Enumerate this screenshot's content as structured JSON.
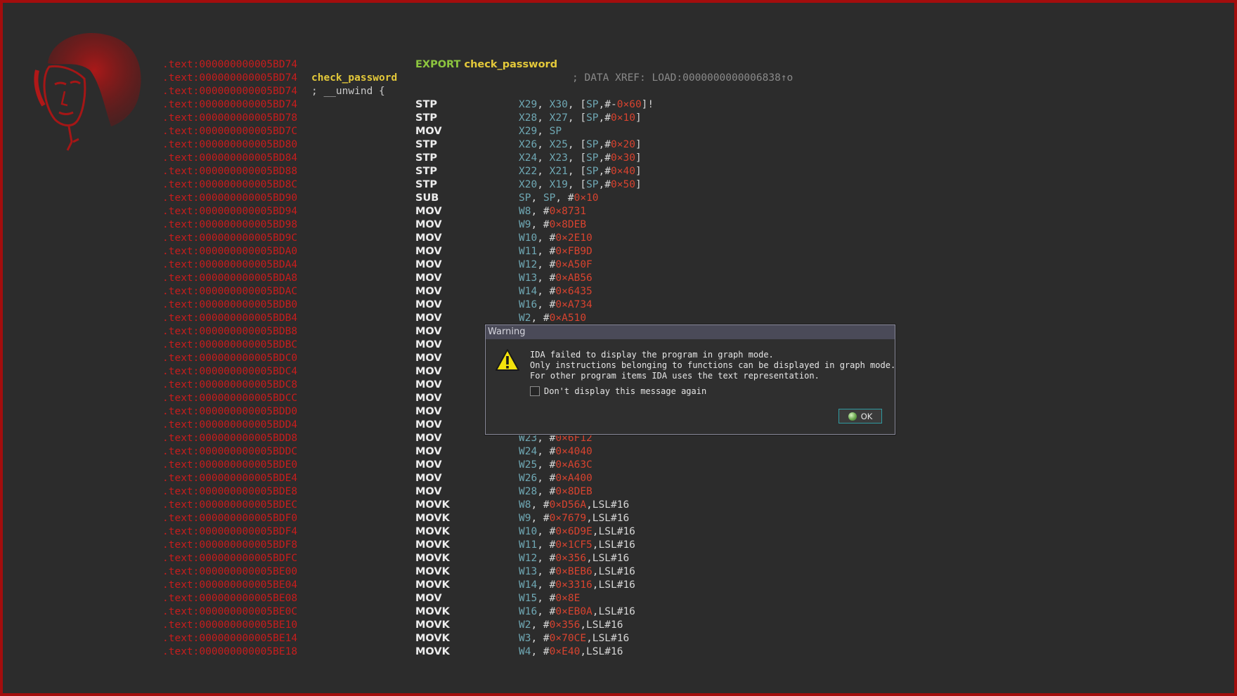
{
  "listing": [
    {
      "addr": ".text:000000000005BD74",
      "label": "",
      "mnem": "EXPORT",
      "name": "check_password",
      "ops": [],
      "comment": ""
    },
    {
      "addr": ".text:000000000005BD74",
      "label": "check_password",
      "mnem": "",
      "ops": [],
      "comment": "; DATA XREF: LOAD:0000000000006838↑o"
    },
    {
      "addr": ".text:000000000005BD74",
      "label": "; __unwind {",
      "label_plain": true,
      "mnem": "",
      "ops": [],
      "comment": ""
    },
    {
      "addr": ".text:000000000005BD74",
      "mnem": "STP",
      "ops": [
        [
          "r",
          "X29"
        ],
        [
          "p",
          ", "
        ],
        [
          "r",
          "X30"
        ],
        [
          "p",
          ", ["
        ],
        [
          "r",
          "SP"
        ],
        [
          "p",
          ",#-"
        ],
        [
          "n",
          "0×60"
        ],
        [
          "p",
          "]!"
        ]
      ]
    },
    {
      "addr": ".text:000000000005BD78",
      "mnem": "STP",
      "ops": [
        [
          "r",
          "X28"
        ],
        [
          "p",
          ", "
        ],
        [
          "r",
          "X27"
        ],
        [
          "p",
          ", ["
        ],
        [
          "r",
          "SP"
        ],
        [
          "p",
          ",#"
        ],
        [
          "n",
          "0×10"
        ],
        [
          "p",
          "]"
        ]
      ]
    },
    {
      "addr": ".text:000000000005BD7C",
      "mnem": "MOV",
      "ops": [
        [
          "r",
          "X29"
        ],
        [
          "p",
          ", "
        ],
        [
          "r",
          "SP"
        ]
      ]
    },
    {
      "addr": ".text:000000000005BD80",
      "mnem": "STP",
      "ops": [
        [
          "r",
          "X26"
        ],
        [
          "p",
          ", "
        ],
        [
          "r",
          "X25"
        ],
        [
          "p",
          ", ["
        ],
        [
          "r",
          "SP"
        ],
        [
          "p",
          ",#"
        ],
        [
          "n",
          "0×20"
        ],
        [
          "p",
          "]"
        ]
      ]
    },
    {
      "addr": ".text:000000000005BD84",
      "mnem": "STP",
      "ops": [
        [
          "r",
          "X24"
        ],
        [
          "p",
          ", "
        ],
        [
          "r",
          "X23"
        ],
        [
          "p",
          ", ["
        ],
        [
          "r",
          "SP"
        ],
        [
          "p",
          ",#"
        ],
        [
          "n",
          "0×30"
        ],
        [
          "p",
          "]"
        ]
      ]
    },
    {
      "addr": ".text:000000000005BD88",
      "mnem": "STP",
      "ops": [
        [
          "r",
          "X22"
        ],
        [
          "p",
          ", "
        ],
        [
          "r",
          "X21"
        ],
        [
          "p",
          ", ["
        ],
        [
          "r",
          "SP"
        ],
        [
          "p",
          ",#"
        ],
        [
          "n",
          "0×40"
        ],
        [
          "p",
          "]"
        ]
      ]
    },
    {
      "addr": ".text:000000000005BD8C",
      "mnem": "STP",
      "ops": [
        [
          "r",
          "X20"
        ],
        [
          "p",
          ", "
        ],
        [
          "r",
          "X19"
        ],
        [
          "p",
          ", ["
        ],
        [
          "r",
          "SP"
        ],
        [
          "p",
          ",#"
        ],
        [
          "n",
          "0×50"
        ],
        [
          "p",
          "]"
        ]
      ]
    },
    {
      "addr": ".text:000000000005BD90",
      "mnem": "SUB",
      "ops": [
        [
          "r",
          "SP"
        ],
        [
          "p",
          ", "
        ],
        [
          "r",
          "SP"
        ],
        [
          "p",
          ", #"
        ],
        [
          "n",
          "0×10"
        ]
      ]
    },
    {
      "addr": ".text:000000000005BD94",
      "mnem": "MOV",
      "ops": [
        [
          "r",
          "W8"
        ],
        [
          "p",
          ", #"
        ],
        [
          "n",
          "0×8731"
        ]
      ]
    },
    {
      "addr": ".text:000000000005BD98",
      "mnem": "MOV",
      "ops": [
        [
          "r",
          "W9"
        ],
        [
          "p",
          ", #"
        ],
        [
          "n",
          "0×8DEB"
        ]
      ]
    },
    {
      "addr": ".text:000000000005BD9C",
      "mnem": "MOV",
      "ops": [
        [
          "r",
          "W10"
        ],
        [
          "p",
          ", #"
        ],
        [
          "n",
          "0×2E10"
        ]
      ]
    },
    {
      "addr": ".text:000000000005BDA0",
      "mnem": "MOV",
      "ops": [
        [
          "r",
          "W11"
        ],
        [
          "p",
          ", #"
        ],
        [
          "n",
          "0×FB9D"
        ]
      ]
    },
    {
      "addr": ".text:000000000005BDA4",
      "mnem": "MOV",
      "ops": [
        [
          "r",
          "W12"
        ],
        [
          "p",
          ", #"
        ],
        [
          "n",
          "0×A50F"
        ]
      ]
    },
    {
      "addr": ".text:000000000005BDA8",
      "mnem": "MOV",
      "ops": [
        [
          "r",
          "W13"
        ],
        [
          "p",
          ", #"
        ],
        [
          "n",
          "0×AB56"
        ]
      ]
    },
    {
      "addr": ".text:000000000005BDAC",
      "mnem": "MOV",
      "ops": [
        [
          "r",
          "W14"
        ],
        [
          "p",
          ", #"
        ],
        [
          "n",
          "0×6435"
        ]
      ]
    },
    {
      "addr": ".text:000000000005BDB0",
      "mnem": "MOV",
      "ops": [
        [
          "r",
          "W16"
        ],
        [
          "p",
          ", #"
        ],
        [
          "n",
          "0×A734"
        ]
      ]
    },
    {
      "addr": ".text:000000000005BDB4",
      "mnem": "MOV",
      "ops": [
        [
          "r",
          "W2"
        ],
        [
          "p",
          ", #"
        ],
        [
          "n",
          "0×A510"
        ]
      ]
    },
    {
      "addr": ".text:000000000005BDB8",
      "mnem": "MOV",
      "ops": []
    },
    {
      "addr": ".text:000000000005BDBC",
      "mnem": "MOV",
      "ops": []
    },
    {
      "addr": ".text:000000000005BDC0",
      "mnem": "MOV",
      "ops": []
    },
    {
      "addr": ".text:000000000005BDC4",
      "mnem": "MOV",
      "ops": []
    },
    {
      "addr": ".text:000000000005BDC8",
      "mnem": "MOV",
      "ops": []
    },
    {
      "addr": ".text:000000000005BDCC",
      "mnem": "MOV",
      "ops": []
    },
    {
      "addr": ".text:000000000005BDD0",
      "mnem": "MOV",
      "ops": []
    },
    {
      "addr": ".text:000000000005BDD4",
      "mnem": "MOV",
      "ops": []
    },
    {
      "addr": ".text:000000000005BDD8",
      "mnem": "MOV",
      "ops": [
        [
          "r",
          "W23"
        ],
        [
          "p",
          ", #"
        ],
        [
          "n",
          "0×6F12"
        ]
      ]
    },
    {
      "addr": ".text:000000000005BDDC",
      "mnem": "MOV",
      "ops": [
        [
          "r",
          "W24"
        ],
        [
          "p",
          ", #"
        ],
        [
          "n",
          "0×4040"
        ]
      ]
    },
    {
      "addr": ".text:000000000005BDE0",
      "mnem": "MOV",
      "ops": [
        [
          "r",
          "W25"
        ],
        [
          "p",
          ", #"
        ],
        [
          "n",
          "0×A63C"
        ]
      ]
    },
    {
      "addr": ".text:000000000005BDE4",
      "mnem": "MOV",
      "ops": [
        [
          "r",
          "W26"
        ],
        [
          "p",
          ", #"
        ],
        [
          "n",
          "0×A400"
        ]
      ]
    },
    {
      "addr": ".text:000000000005BDE8",
      "mnem": "MOV",
      "ops": [
        [
          "r",
          "W28"
        ],
        [
          "p",
          ", #"
        ],
        [
          "n",
          "0×8DEB"
        ]
      ]
    },
    {
      "addr": ".text:000000000005BDEC",
      "mnem": "MOVK",
      "ops": [
        [
          "r",
          "W8"
        ],
        [
          "p",
          ", #"
        ],
        [
          "n",
          "0×D56A"
        ],
        [
          "p",
          ",LSL#16"
        ]
      ]
    },
    {
      "addr": ".text:000000000005BDF0",
      "mnem": "MOVK",
      "ops": [
        [
          "r",
          "W9"
        ],
        [
          "p",
          ", #"
        ],
        [
          "n",
          "0×7679"
        ],
        [
          "p",
          ",LSL#16"
        ]
      ]
    },
    {
      "addr": ".text:000000000005BDF4",
      "mnem": "MOVK",
      "ops": [
        [
          "r",
          "W10"
        ],
        [
          "p",
          ", #"
        ],
        [
          "n",
          "0×6D9E"
        ],
        [
          "p",
          ",LSL#16"
        ]
      ]
    },
    {
      "addr": ".text:000000000005BDF8",
      "mnem": "MOVK",
      "ops": [
        [
          "r",
          "W11"
        ],
        [
          "p",
          ", #"
        ],
        [
          "n",
          "0×1CF5"
        ],
        [
          "p",
          ",LSL#16"
        ]
      ]
    },
    {
      "addr": ".text:000000000005BDFC",
      "mnem": "MOVK",
      "ops": [
        [
          "r",
          "W12"
        ],
        [
          "p",
          ", #"
        ],
        [
          "n",
          "0×356"
        ],
        [
          "p",
          ",LSL#16"
        ]
      ]
    },
    {
      "addr": ".text:000000000005BE00",
      "mnem": "MOVK",
      "ops": [
        [
          "r",
          "W13"
        ],
        [
          "p",
          ", #"
        ],
        [
          "n",
          "0×BEB6"
        ],
        [
          "p",
          ",LSL#16"
        ]
      ]
    },
    {
      "addr": ".text:000000000005BE04",
      "mnem": "MOVK",
      "ops": [
        [
          "r",
          "W14"
        ],
        [
          "p",
          ", #"
        ],
        [
          "n",
          "0×3316"
        ],
        [
          "p",
          ",LSL#16"
        ]
      ]
    },
    {
      "addr": ".text:000000000005BE08",
      "mnem": "MOV",
      "ops": [
        [
          "r",
          "W15"
        ],
        [
          "p",
          ", #"
        ],
        [
          "n",
          "0×8E"
        ]
      ]
    },
    {
      "addr": ".text:000000000005BE0C",
      "mnem": "MOVK",
      "ops": [
        [
          "r",
          "W16"
        ],
        [
          "p",
          ", #"
        ],
        [
          "n",
          "0×EB0A"
        ],
        [
          "p",
          ",LSL#16"
        ]
      ]
    },
    {
      "addr": ".text:000000000005BE10",
      "mnem": "MOVK",
      "ops": [
        [
          "r",
          "W2"
        ],
        [
          "p",
          ", #"
        ],
        [
          "n",
          "0×356"
        ],
        [
          "p",
          ",LSL#16"
        ]
      ]
    },
    {
      "addr": ".text:000000000005BE14",
      "mnem": "MOVK",
      "ops": [
        [
          "r",
          "W3"
        ],
        [
          "p",
          ", #"
        ],
        [
          "n",
          "0×70CE"
        ],
        [
          "p",
          ",LSL#16"
        ]
      ]
    },
    {
      "addr": ".text:000000000005BE18",
      "mnem": "MOVK",
      "ops": [
        [
          "r",
          "W4"
        ],
        [
          "p",
          ", #"
        ],
        [
          "n",
          "0×E40"
        ],
        [
          "p",
          ",LSL#16"
        ]
      ]
    }
  ],
  "dialog": {
    "title": "Warning",
    "icon": "warning-triangle-icon",
    "message_lines": [
      "IDA failed to display the program in graph mode.",
      "Only instructions belonging to functions can be displayed in graph mode.",
      "For other program items IDA uses the text representation."
    ],
    "checkbox_label": "Don't display this message again",
    "checkbox_checked": false,
    "ok_label": "OK"
  },
  "colors": {
    "address": "#c81d1d",
    "frame_border": "#a30d0d",
    "label": "#e4c93a",
    "register": "#6fa8b4",
    "number": "#d8432f",
    "keyword": "#8dc63f",
    "comment": "#8a8a8a"
  }
}
